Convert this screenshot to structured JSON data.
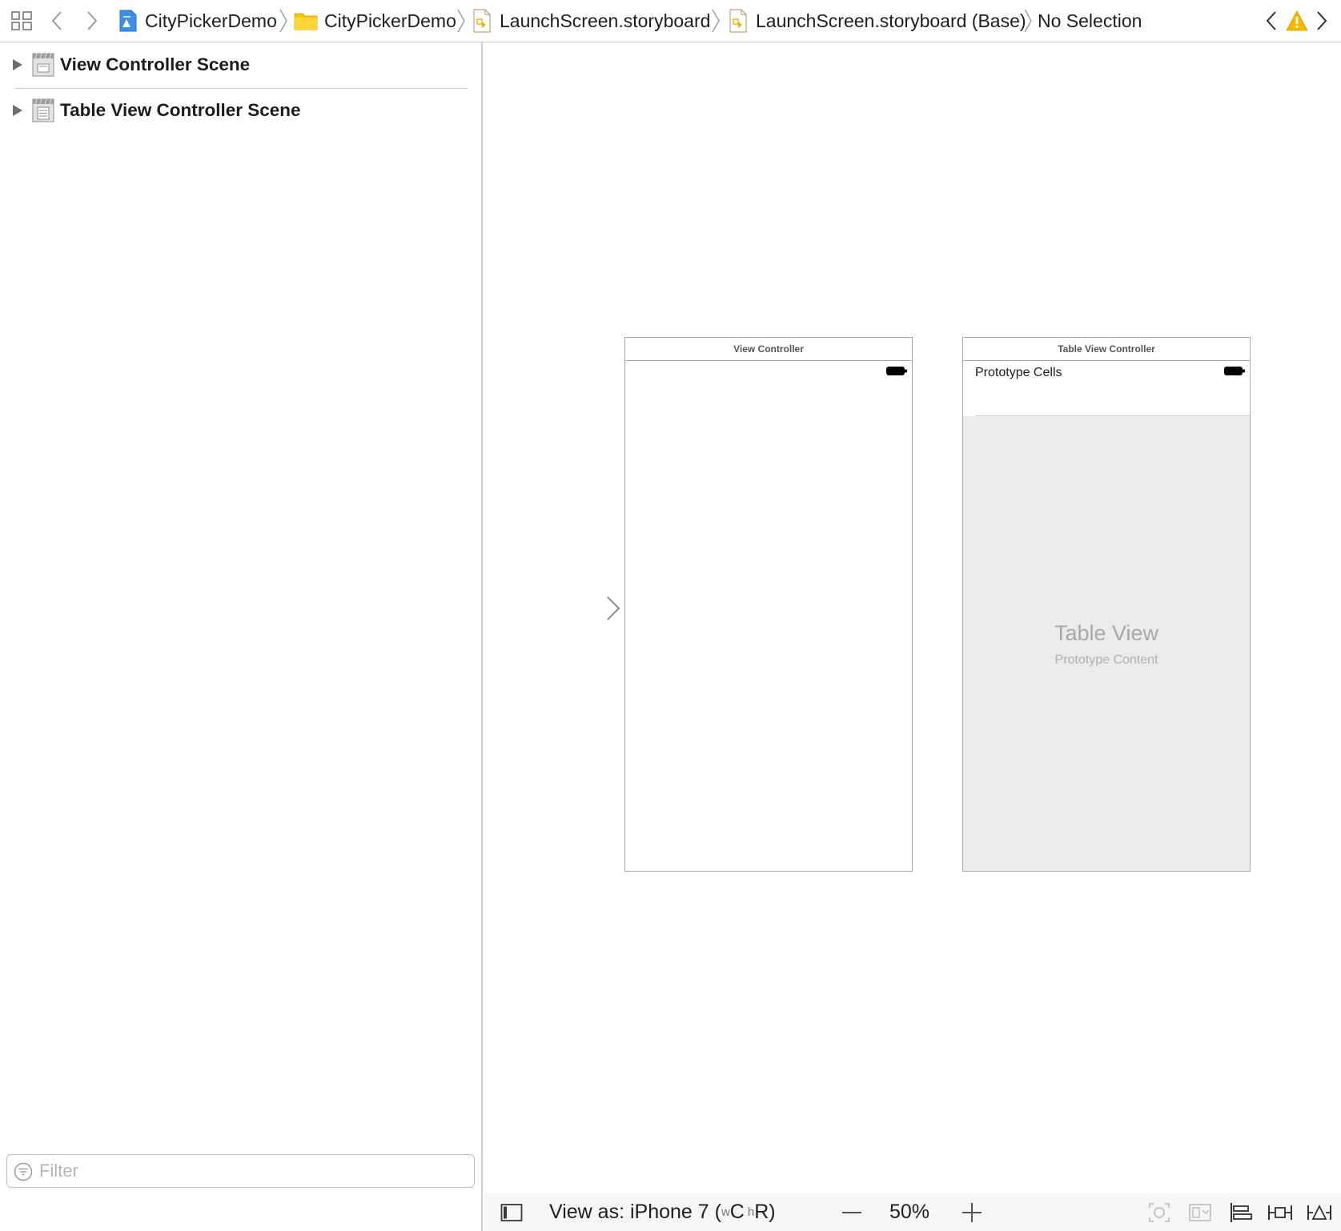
{
  "jumpbar": {
    "related_items_icon": "grid-icon",
    "back_icon": "chevron-left-icon",
    "forward_icon": "chevron-right-icon",
    "breadcrumbs": [
      {
        "label": "CityPickerDemo",
        "icon": "project-icon"
      },
      {
        "label": "CityPickerDemo",
        "icon": "folder-icon",
        "color": "#f5c518"
      },
      {
        "label": "LaunchScreen.storyboard",
        "icon": "storyboard-file-icon"
      },
      {
        "label": "LaunchScreen.storyboard (Base)",
        "icon": "storyboard-file-icon"
      },
      {
        "label": "No Selection"
      }
    ],
    "issue_icon": "warning-icon",
    "warning_color": "#f5b800"
  },
  "navigator": {
    "scenes": [
      {
        "label": "View Controller Scene",
        "icon": "scene-icon"
      },
      {
        "label": "Table View Controller Scene",
        "icon": "table-scene-icon"
      }
    ],
    "filter_placeholder": "Filter"
  },
  "canvas": {
    "view_controller": {
      "title": "View Controller"
    },
    "table_view_controller": {
      "title": "Table View Controller",
      "prototype_cells_label": "Prototype Cells",
      "table_view_label": "Table View",
      "prototype_content_label": "Prototype Content"
    }
  },
  "bottombar": {
    "view_as_prefix": "View as: iPhone 7 (",
    "size_w": "w",
    "size_c": "C ",
    "size_h": "h",
    "size_r": "R)",
    "zoom_level": "50%"
  }
}
